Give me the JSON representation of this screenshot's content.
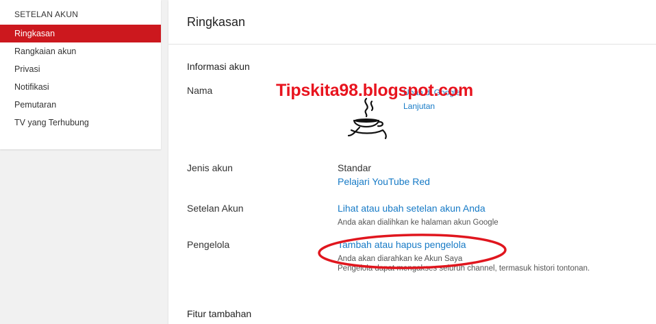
{
  "sidebar": {
    "title": "SETELAN AKUN",
    "items": [
      {
        "label": "Ringkasan",
        "active": true
      },
      {
        "label": "Rangkaian akun"
      },
      {
        "label": "Privasi"
      },
      {
        "label": "Notifikasi"
      },
      {
        "label": "Pemutaran"
      },
      {
        "label": "TV yang Terhubung"
      }
    ]
  },
  "main": {
    "title": "Ringkasan",
    "section_info": "Informasi akun",
    "section_extra": "Fitur tambahan",
    "nama": {
      "label": "Nama",
      "link1": "Ubah di Google",
      "link2": "Lanjutan"
    },
    "jenis": {
      "label": "Jenis akun",
      "value": "Standar",
      "link": "Pelajari YouTube Red"
    },
    "setelan": {
      "label": "Setelan Akun",
      "link": "Lihat atau ubah setelan akun Anda",
      "hint": "Anda akan dialihkan ke halaman akun Google"
    },
    "pengelola": {
      "label": "Pengelola",
      "link": "Tambah atau hapus pengelola",
      "hint1": "Anda akan diarahkan ke Akun Saya",
      "hint2": "Pengelola dapat mengakses seluruh channel, termasuk histori tontonan."
    }
  },
  "watermark": {
    "text": "Tipskita98.blogspot.com",
    "logo_icon": "coffee-cup-icon"
  },
  "colors": {
    "accent": "#cc181e",
    "link": "#167ac6",
    "watermark": "#e8141f",
    "annotation": "#e0161e"
  }
}
